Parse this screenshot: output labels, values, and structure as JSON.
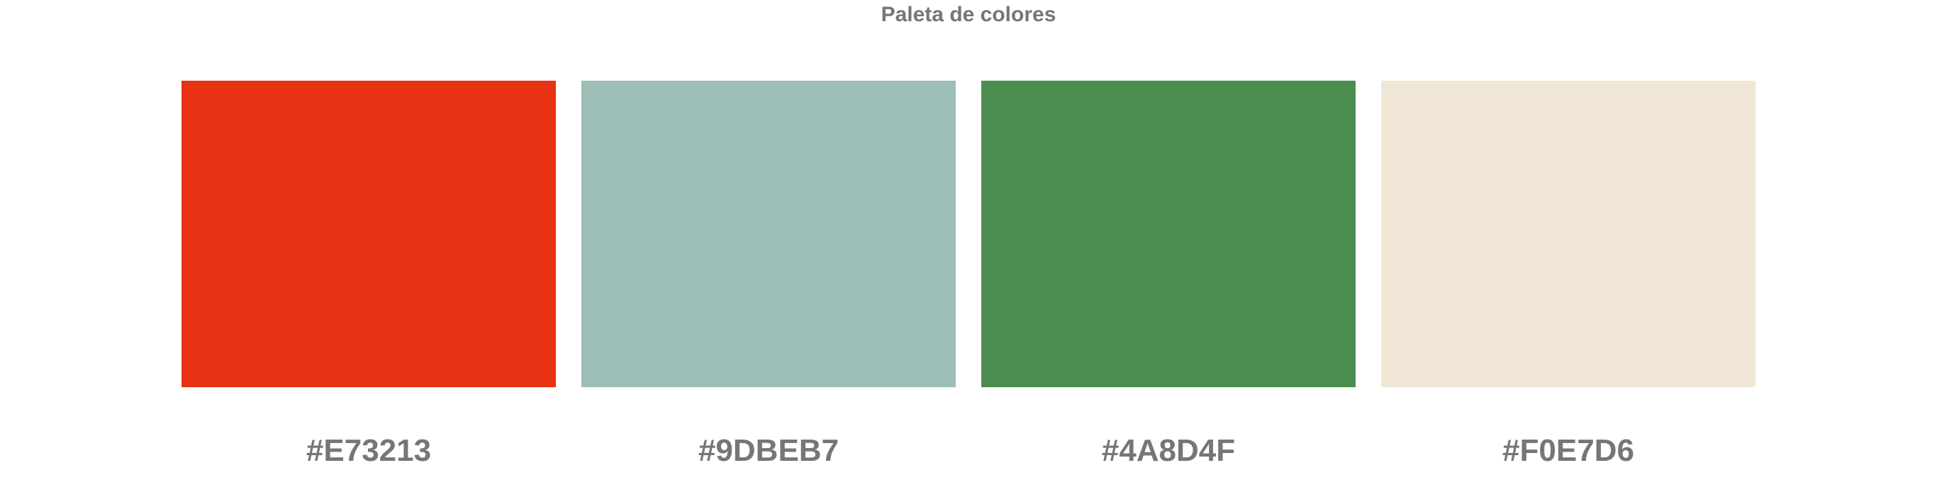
{
  "title": "Paleta de colores",
  "swatches": [
    {
      "label": "#E73213",
      "color": "#E73213"
    },
    {
      "label": "#9DBEB7",
      "color": "#9DBEB7"
    },
    {
      "label": "#4A8D4F",
      "color": "#4A8D4F"
    },
    {
      "label": "#F0E7D6",
      "color": "#F0E7D6"
    }
  ]
}
